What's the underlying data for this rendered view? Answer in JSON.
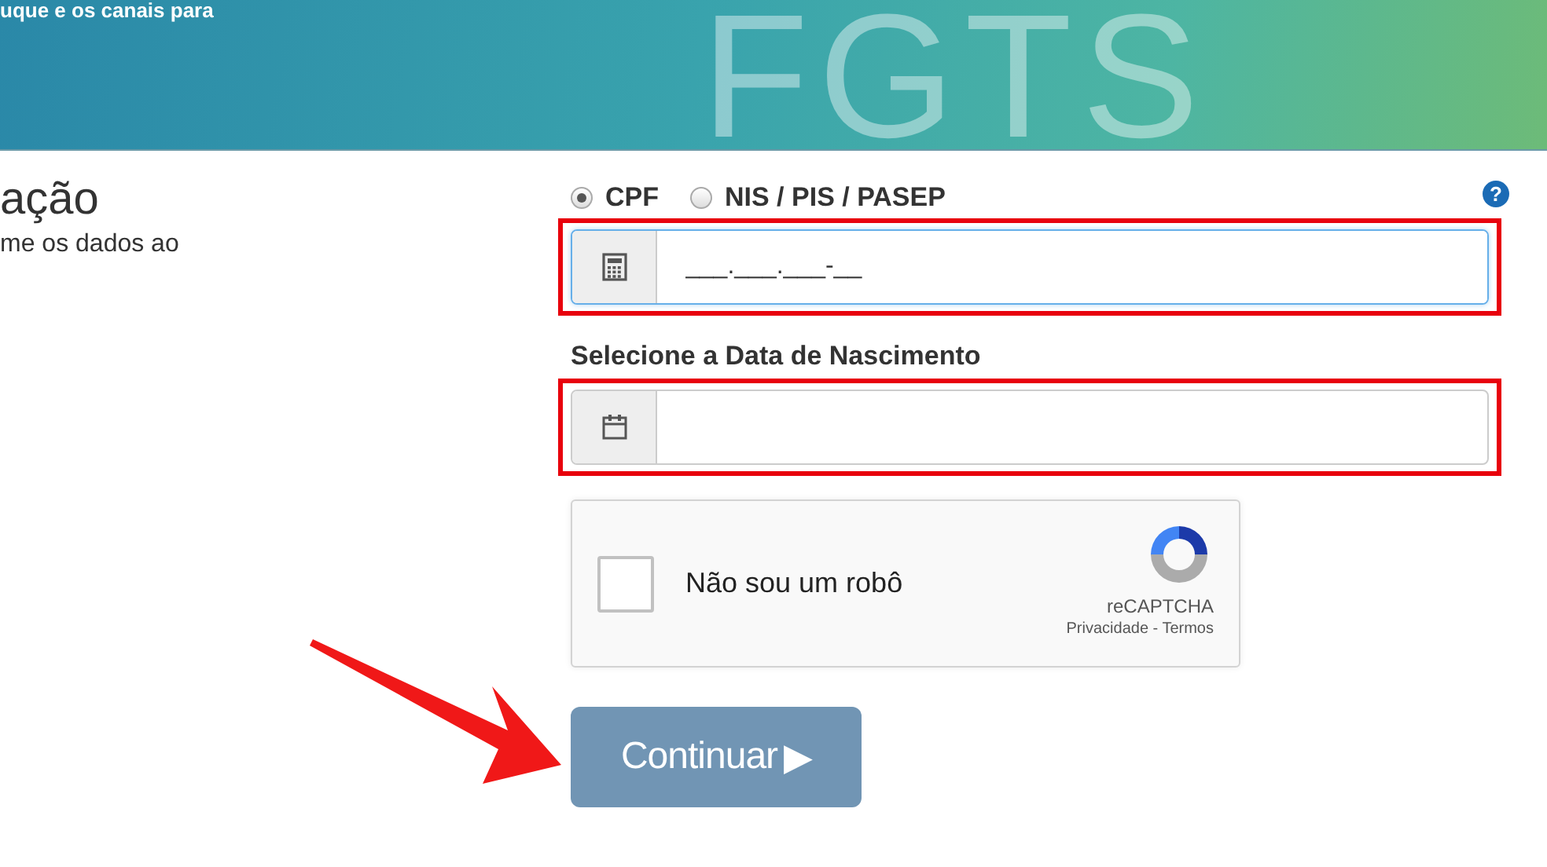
{
  "banner": {
    "caption": "uque e os canais para",
    "watermark": "FGTS"
  },
  "intro": {
    "title": "ação",
    "text": "me os dados ao"
  },
  "form": {
    "doc_types": [
      {
        "label": "CPF",
        "selected": true
      },
      {
        "label": "NIS / PIS / PASEP",
        "selected": false
      }
    ],
    "help": "?",
    "document_field": {
      "value": "___.___.___-__",
      "highlighted": true
    },
    "birth_label": "Selecione a Data de Nascimento",
    "birth_field": {
      "highlighted": true
    },
    "captcha": {
      "label": "Não sou um robô",
      "checked": false,
      "brand": "reCAPTCHA",
      "links": "Privacidade - Termos"
    },
    "submit": {
      "label": "Continuar",
      "arrow": "▶"
    }
  }
}
